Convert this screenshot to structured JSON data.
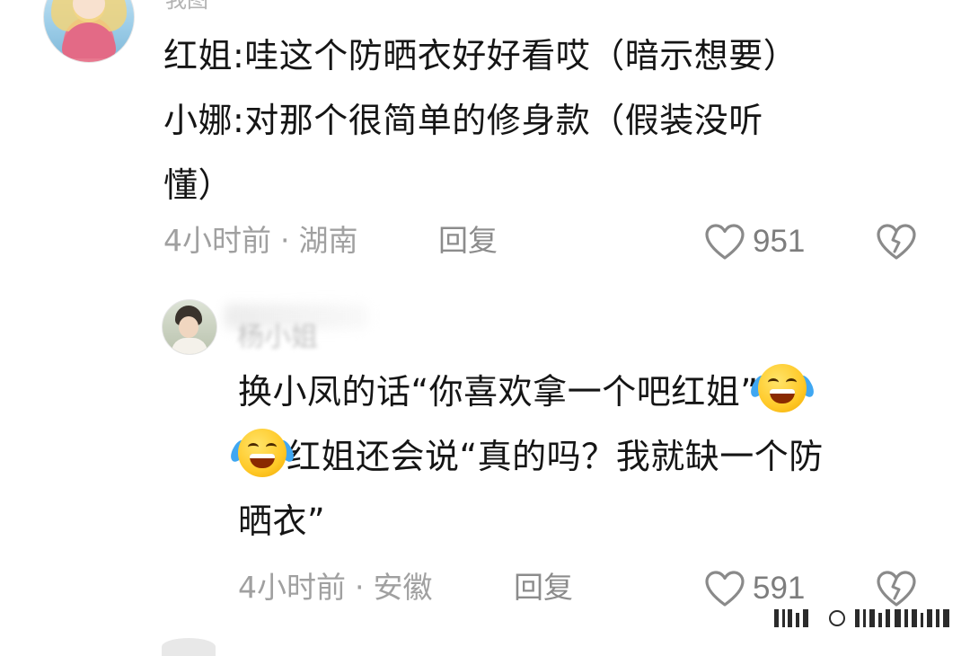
{
  "comments": [
    {
      "username": "我图",
      "lines": [
        "红姐:哇这个防晒衣好好看哎（暗示想要）",
        "小娜:对那个很简单的修身款（假装没听",
        "懂）"
      ],
      "time": "4小时前",
      "location": "湖南",
      "reply_label": "回复",
      "likes": "951"
    },
    {
      "username": "杨小姐",
      "lines": [
        "换小凤的话“你喜欢拿一个吧红姐”",
        "红姐还会说“真的吗？我就缺一个防",
        "晒衣”"
      ],
      "time": "4小时前",
      "location": "安徽",
      "reply_label": "回复",
      "likes": "591"
    }
  ],
  "meta": {
    "separator": "·"
  },
  "icons": {
    "like": "heart-outline-icon",
    "dislike": "broken-heart-icon",
    "emoji": "face-with-tears-of-joy-icon"
  }
}
